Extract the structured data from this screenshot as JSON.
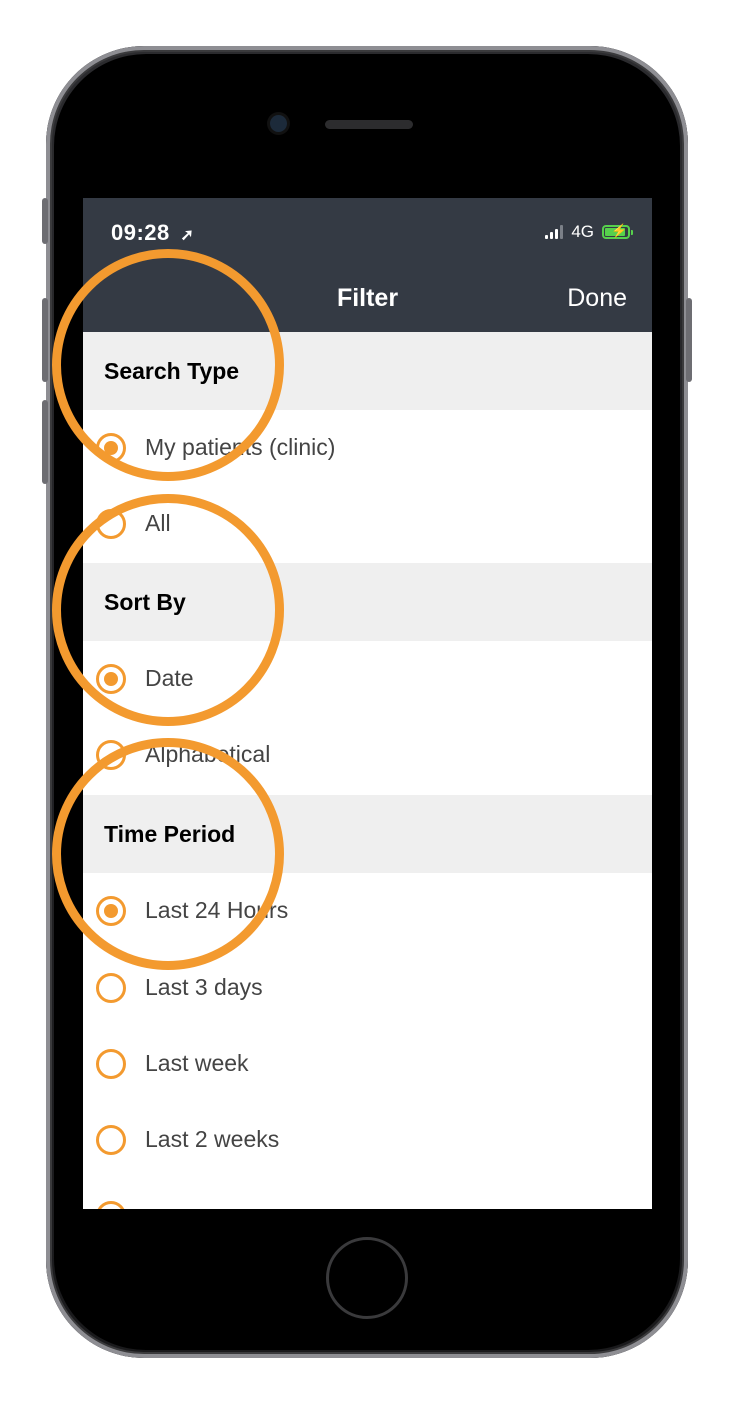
{
  "status": {
    "time": "09:28",
    "network": "4G"
  },
  "navbar": {
    "title": "Filter",
    "done_label": "Done"
  },
  "sections": {
    "search_type": {
      "title": "Search Type",
      "options": [
        {
          "label": "My patients (clinic)",
          "selected": true
        },
        {
          "label": "All",
          "selected": false
        }
      ]
    },
    "sort_by": {
      "title": "Sort By",
      "options": [
        {
          "label": "Date",
          "selected": true
        },
        {
          "label": "Alphabetical",
          "selected": false
        }
      ]
    },
    "time_period": {
      "title": "Time Period",
      "options": [
        {
          "label": "Last 24 Hours",
          "selected": true
        },
        {
          "label": "Last 3 days",
          "selected": false
        },
        {
          "label": "Last week",
          "selected": false
        },
        {
          "label": "Last 2 weeks",
          "selected": false
        }
      ]
    }
  },
  "colors": {
    "accent": "#f39a2f",
    "navbar": "#343a44",
    "section_bg": "#efefef",
    "battery": "#56d14c"
  },
  "icons": [
    "location-arrow-icon",
    "signal-bars-icon",
    "battery-charging-icon",
    "radio-button-icon"
  ]
}
